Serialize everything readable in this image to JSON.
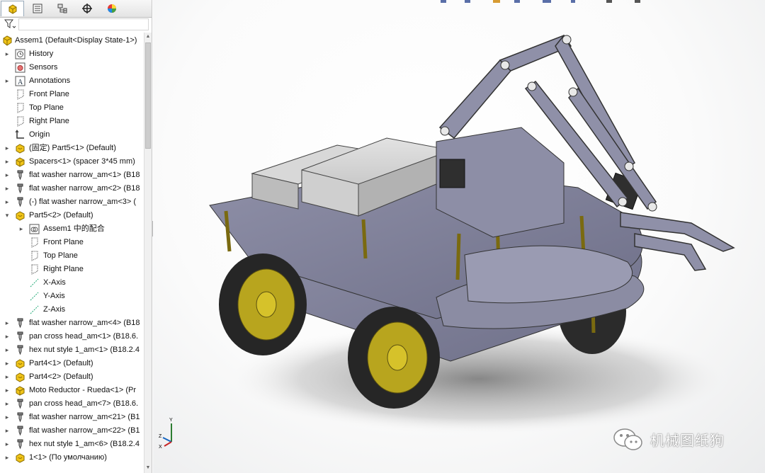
{
  "panel": {
    "tabs": [
      {
        "name": "feature-manager",
        "active": true
      },
      {
        "name": "property-manager",
        "active": false
      },
      {
        "name": "configuration-manager",
        "active": false
      },
      {
        "name": "dimxpert-manager",
        "active": false
      },
      {
        "name": "display-manager",
        "active": false
      }
    ],
    "root_label": "Assem1  (Default<Display State-1>)",
    "tree": [
      {
        "indent": 1,
        "expand": "▸",
        "icon": "history",
        "label": "History"
      },
      {
        "indent": 1,
        "expand": "",
        "icon": "sensors",
        "label": "Sensors"
      },
      {
        "indent": 1,
        "expand": "▸",
        "icon": "annotations",
        "label": "Annotations"
      },
      {
        "indent": 1,
        "expand": "",
        "icon": "plane",
        "label": "Front Plane"
      },
      {
        "indent": 1,
        "expand": "",
        "icon": "plane",
        "label": "Top Plane"
      },
      {
        "indent": 1,
        "expand": "",
        "icon": "plane",
        "label": "Right Plane"
      },
      {
        "indent": 1,
        "expand": "",
        "icon": "origin",
        "label": "Origin"
      },
      {
        "indent": 1,
        "expand": "▸",
        "icon": "part",
        "label": "(固定) Part5<1> (Default)"
      },
      {
        "indent": 1,
        "expand": "▸",
        "icon": "subassembly",
        "label": "Spacers<1> (spacer 3*45 mm)"
      },
      {
        "indent": 1,
        "expand": "▸",
        "icon": "toolbox",
        "label": "flat washer narrow_am<1> (B18"
      },
      {
        "indent": 1,
        "expand": "▸",
        "icon": "toolbox",
        "label": "flat washer narrow_am<2> (B18"
      },
      {
        "indent": 1,
        "expand": "▸",
        "icon": "toolbox",
        "label": "(-) flat washer narrow_am<3> ("
      },
      {
        "indent": 1,
        "expand": "▾",
        "icon": "part",
        "label": "Part5<2> (Default)"
      },
      {
        "indent": 2,
        "expand": "▸",
        "icon": "mates",
        "label": "Assem1 中的配合"
      },
      {
        "indent": 2,
        "expand": "",
        "icon": "plane",
        "label": "Front Plane"
      },
      {
        "indent": 2,
        "expand": "",
        "icon": "plane",
        "label": "Top Plane"
      },
      {
        "indent": 2,
        "expand": "",
        "icon": "plane",
        "label": "Right Plane"
      },
      {
        "indent": 2,
        "expand": "",
        "icon": "axis",
        "label": "X-Axis"
      },
      {
        "indent": 2,
        "expand": "",
        "icon": "axis",
        "label": "Y-Axis"
      },
      {
        "indent": 2,
        "expand": "",
        "icon": "axis",
        "label": "Z-Axis"
      },
      {
        "indent": 1,
        "expand": "▸",
        "icon": "toolbox",
        "label": "flat washer narrow_am<4> (B18"
      },
      {
        "indent": 1,
        "expand": "▸",
        "icon": "toolbox",
        "label": "pan cross head_am<1> (B18.6."
      },
      {
        "indent": 1,
        "expand": "▸",
        "icon": "toolbox",
        "label": "hex nut style 1_am<1> (B18.2.4"
      },
      {
        "indent": 1,
        "expand": "▸",
        "icon": "part",
        "label": "Part4<1> (Default)"
      },
      {
        "indent": 1,
        "expand": "▸",
        "icon": "part",
        "label": "Part4<2> (Default)"
      },
      {
        "indent": 1,
        "expand": "▸",
        "icon": "subassembly",
        "label": "Moto Reductor - Rueda<1> (Pr"
      },
      {
        "indent": 1,
        "expand": "▸",
        "icon": "toolbox",
        "label": "pan cross head_am<7> (B18.6."
      },
      {
        "indent": 1,
        "expand": "▸",
        "icon": "toolbox",
        "label": "flat washer narrow_am<21> (B1"
      },
      {
        "indent": 1,
        "expand": "▸",
        "icon": "toolbox",
        "label": "flat washer narrow_am<22> (B1"
      },
      {
        "indent": 1,
        "expand": "▸",
        "icon": "toolbox",
        "label": "hex nut style 1_am<6> (B18.2.4"
      },
      {
        "indent": 1,
        "expand": "▸",
        "icon": "part",
        "label": "1<1> (По умолчанию)"
      }
    ]
  },
  "viewport": {
    "triad_axes": [
      "Y",
      "Z",
      "X"
    ],
    "watermark": "机械图纸狗"
  }
}
